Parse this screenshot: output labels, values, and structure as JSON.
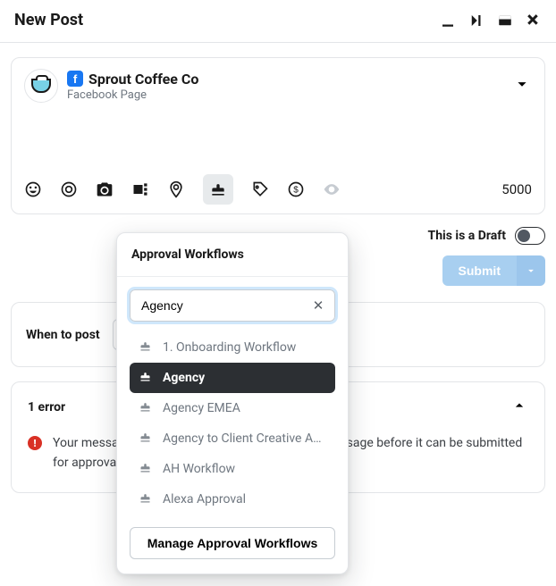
{
  "header": {
    "title": "New Post"
  },
  "composer": {
    "account_name": "Sprout Coffee Co",
    "account_type": "Facebook Page",
    "char_limit": "5000"
  },
  "draft": {
    "label": "This is a Draft"
  },
  "submit": {
    "label": "Submit"
  },
  "when": {
    "label": "When to post"
  },
  "errors": {
    "title": "1 error",
    "message_left": "Your messa",
    "message_right": "sage before it can be submitted for approval."
  },
  "workflow_popover": {
    "title": "Approval Workflows",
    "search_value": "Agency",
    "manage_label": "Manage Approval Workflows",
    "items": [
      {
        "label": "1. Onboarding Workflow",
        "selected": false
      },
      {
        "label": "Agency",
        "selected": true
      },
      {
        "label": "Agency EMEA",
        "selected": false
      },
      {
        "label": "Agency to Client Creative Ap…",
        "selected": false
      },
      {
        "label": "AH Workflow",
        "selected": false
      },
      {
        "label": "Alexa Approval",
        "selected": false
      }
    ]
  }
}
